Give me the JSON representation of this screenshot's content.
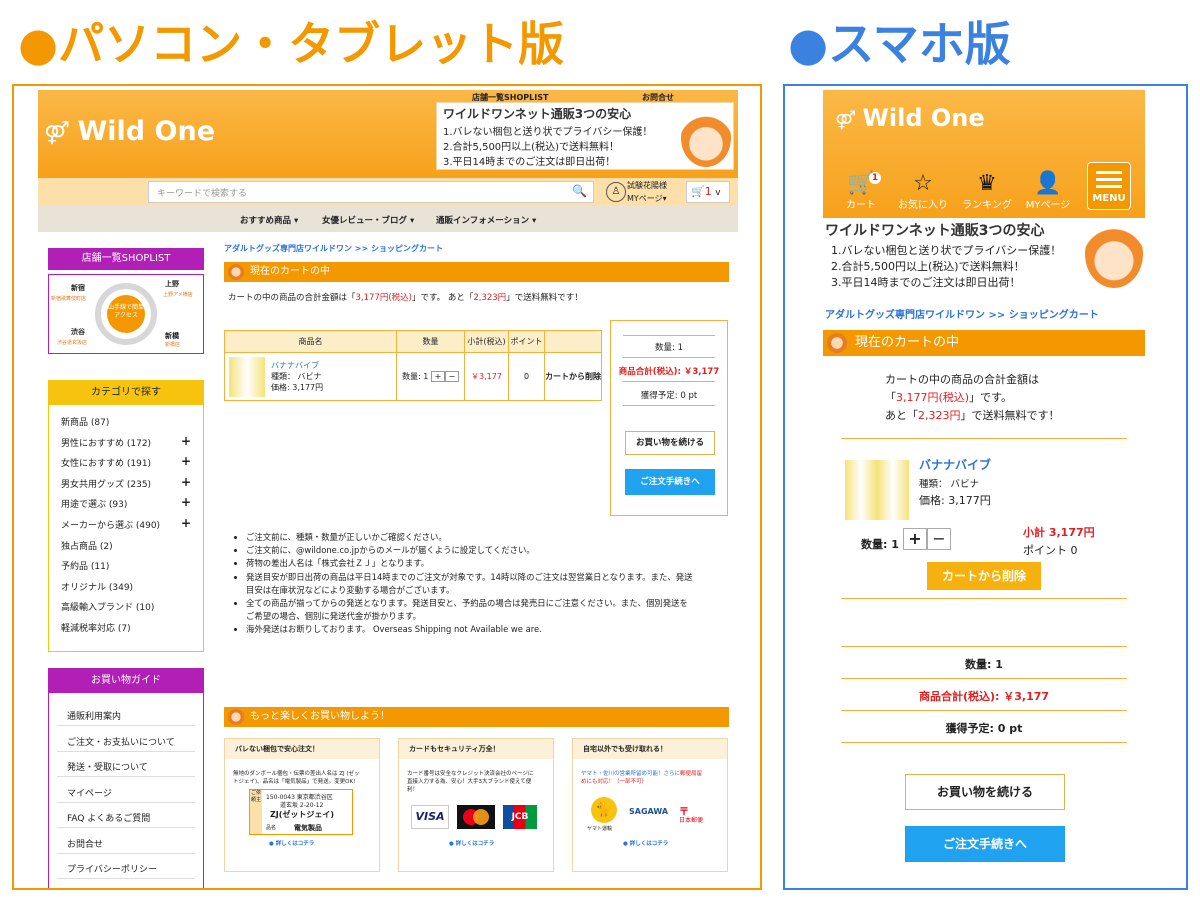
{
  "headings": {
    "pc": "●パソコン・タブレット版",
    "sp": "●スマホ版"
  },
  "colors": {
    "orange": "#f39800",
    "blue": "#3b82e0",
    "purple": "#b11fb7",
    "red": "#e02020",
    "link_blue": "#2b73d8"
  },
  "pc": {
    "top_links": {
      "shoplist": "店舗一覧SHOPLIST",
      "contact": "お問合せ"
    },
    "logo": "Wild One",
    "banner": {
      "title": "ワイルドワンネット通販3つの安心",
      "lines": [
        "1.バレない梱包と送り状でプライバシー保護！",
        "2.合計5,500円以上(税込)で送料無料！",
        "3.平日14時までのご注文は即日出荷！"
      ]
    },
    "search": {
      "placeholder": "キーワードで検索する",
      "icon": "search-icon"
    },
    "user": {
      "name": "試験花陽様",
      "mypage": "MYページ▾"
    },
    "cart": {
      "count": "1",
      "caret": "v"
    },
    "nav": [
      "おすすめ商品 ▾",
      "女優レビュー・ブログ ▾",
      "通販インフォメーション ▾"
    ],
    "breadcrumb": "アダルトグッズ専門店ワイルドワン >> ショッピングカート",
    "cart_title": "現在のカートの中",
    "summary_pre": "カートの中の商品の合計金額は「",
    "summary_total": "3,177円(税込)",
    "summary_mid": "」です。 あと「",
    "summary_remain": "2,323円",
    "summary_post": "」で送料無料です！",
    "table": {
      "headers": [
        "商品名",
        "数量",
        "小計(税込)",
        "ポイント"
      ],
      "item": {
        "name": "バナナバイブ",
        "variant": "種類： バビナ",
        "price": "価格: 3,177円",
        "qty_label": "数量: 1",
        "plus": "+",
        "minus": "−",
        "subtotal": "￥3,177",
        "points": "0",
        "remove": "カートから削除"
      }
    },
    "totals": {
      "qty": "数量: 1",
      "total": "商品合計(税込): ￥3,177",
      "points": "獲得予定: 0 pt"
    },
    "buttons": {
      "continue": "お買い物を続ける",
      "checkout": "ご注文手続きへ"
    },
    "notes": [
      "ご注文前に、種類・数量が正しいかご確認ください。",
      "ご注文前に、@wildone.co.jpからのメールが届くように設定してください。",
      "荷物の差出人名は「株式会社ＺＪ」となります。",
      "発送目安が即日出荷の商品は平日14時までのご注文が対象です。14時以降のご注文は翌営業日となります。また、発送",
      "目安は在庫状況などにより変動する場合がございます。",
      "全ての商品が揃ってからの発送となります。発送目安と、予約品の場合は発売日にご注意ください。また、個別発送を",
      "ご希望の場合、個別に発送代金が掛かります。",
      "海外発送はお断りしております。 Overseas Shipping not Available we are."
    ],
    "sidebar": {
      "shoplist_title": "店舗一覧SHOPLIST",
      "map": {
        "center": "山手線で簡単アクセス",
        "shinjuku": "新宿",
        "ueno": "上野",
        "shibuya": "渋谷",
        "shinbashi": "新橋",
        "shinjuku_sub": "新宿歌舞伎町店",
        "ueno_sub": "上野アメ横店",
        "shibuya_sub": "渋谷道玄坂店",
        "shinbashi_sub": "新橋店"
      },
      "category_title": "カテゴリで探す",
      "categories": [
        "新商品 (87)",
        "男性におすすめ (172)",
        "女性におすすめ (191)",
        "男女共用グッズ (235)",
        "用途で選ぶ (93)",
        "メーカーから選ぶ (490)",
        "独占商品 (2)",
        "予約品 (11)",
        "オリジナル (349)",
        "高級輸入ブランド (10)",
        "軽減税率対応 (7)"
      ],
      "plus": "+",
      "guide_title": "お買い物ガイド",
      "guide": [
        "通販利用案内",
        "ご注文・お支払いについて",
        "発送・受取について",
        "マイページ",
        "FAQ よくあるご質問",
        "お問合せ",
        "プライバシーポリシー"
      ]
    },
    "more_title": "もっと楽しくお買い物しよう！",
    "boxes": [
      {
        "title": "バレない梱包で安心注文！",
        "text1": "無地のダンボール梱包・伝票の差出人名は ZJ (ゼッ",
        "text2": "トジェイ)、品名は「電気製品」で発送。変更OK!",
        "label_zip": "150-0043 東京都渋谷区",
        "label_addr": "道玄坂 2-20-12",
        "label_name": "ZJ(ゼットジェイ)",
        "label_item": "電気製品",
        "label_side1": "ご依頼主",
        "label_side2": "品名",
        "more": "● 詳しくはコチラ"
      },
      {
        "title": "カードもセキュリティ万全！",
        "text1": "カード番号は安全なクレジット決済会社のページに",
        "text2": "直接入力する為、安心！大手3大ブランド使えて便",
        "text3": "利！",
        "visa": "VISA",
        "jcb": "JCB",
        "more": "● 詳しくはコチラ"
      },
      {
        "title": "自宅以外でも受け取れる！",
        "text1": "ヤマト・佐川の営業所留め可能！さらに",
        "text1b": "郵便局留",
        "text2": "めにも対応！（一部不可）",
        "yamato": "ヤマト運輸",
        "sagawa": "SAGAWA",
        "jp": "日本郵便",
        "more": "● 詳しくはコチラ"
      }
    ]
  },
  "sp": {
    "logo": "Wild One",
    "icons": [
      {
        "icon": "cart-icon",
        "label": "カート",
        "badge": "1"
      },
      {
        "icon": "star-icon",
        "label": "お気に入り"
      },
      {
        "icon": "crown-icon",
        "label": "ランキング"
      },
      {
        "icon": "user-icon",
        "label": "MYページ"
      }
    ],
    "menu_label": "MENU",
    "banner": {
      "title": "ワイルドワンネット通販3つの安心",
      "lines": [
        "1.バレない梱包と送り状でプライバシー保護！",
        "2.合計5,500円以上(税込)で送料無料！",
        "3.平日14時までのご注文は即日出荷！"
      ]
    },
    "breadcrumb": "アダルトグッズ専門店ワイルドワン >> ショッピングカート",
    "cart_title": "現在のカートの中",
    "summary1": "カートの中の商品の合計金額は",
    "summary_total": "3,177円(税込)",
    "summary2": "です。",
    "summary3_pre": "あと「",
    "summary_remain": "2,323円",
    "summary3_post": "」で送料無料です！",
    "item": {
      "name": "バナナバイブ",
      "variant": "種類： バビナ",
      "price": "価格: 3,177円",
      "qty_label": "数量: 1",
      "plus": "+",
      "minus": "−",
      "subtotal": "小計 3,177円",
      "points": "ポイント 0",
      "remove": "カートから削除"
    },
    "totals": {
      "qty": "数量: 1",
      "total": "商品合計(税込): ￥3,177",
      "points": "獲得予定: 0 pt"
    },
    "buttons": {
      "continue": "お買い物を続ける",
      "checkout": "ご注文手続きへ"
    }
  }
}
